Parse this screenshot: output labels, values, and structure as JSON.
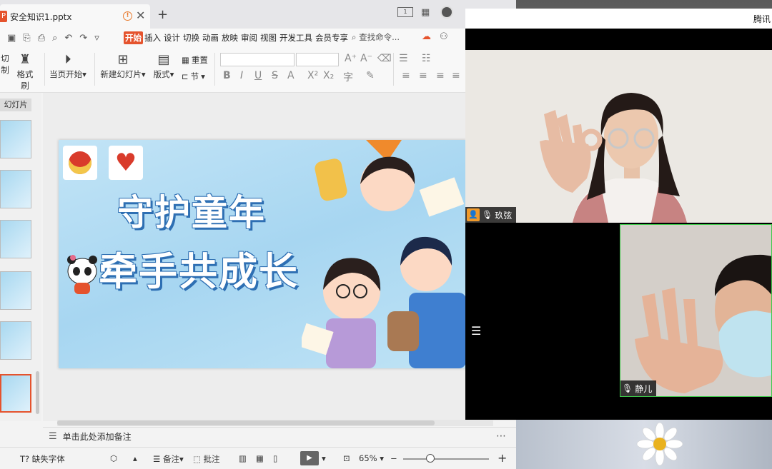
{
  "window": {
    "doc_title": "安全知识1.pptx",
    "app_icon": "P",
    "warn_icon": "!",
    "new_tab": "+",
    "close": "✕"
  },
  "menu": {
    "items": [
      "开始",
      "插入",
      "设计",
      "切换",
      "动画",
      "放映",
      "审阅",
      "视图",
      "开发工具",
      "会员专享"
    ],
    "active": "开始",
    "search": "查找命令..."
  },
  "ribbon": {
    "cut": "切",
    "copy_cut": "制",
    "format_painter": "格式刷",
    "play_from_current": "当页开始",
    "new_slide": "新建幻灯片",
    "layout": "版式",
    "reset": "重置",
    "section": "节",
    "dropdown": "▾"
  },
  "thumbs": {
    "tab_label": "幻灯片"
  },
  "slide": {
    "title_line1": "守护童年",
    "title_line2": "牵手共成长"
  },
  "notes": {
    "placeholder": "单击此处添加备注"
  },
  "statusbar": {
    "missing_font": "缺失字体",
    "notes": "备注",
    "comments": "批注",
    "zoom": "65%",
    "plus": "+",
    "minus": "−"
  },
  "meeting": {
    "title": "腾讯",
    "participant1": "玖弦",
    "participant2": "静儿"
  },
  "colors": {
    "accent": "#e5532d",
    "active_speaker": "#3ec94a",
    "slide_title_shadow": "#2e6fb3"
  }
}
